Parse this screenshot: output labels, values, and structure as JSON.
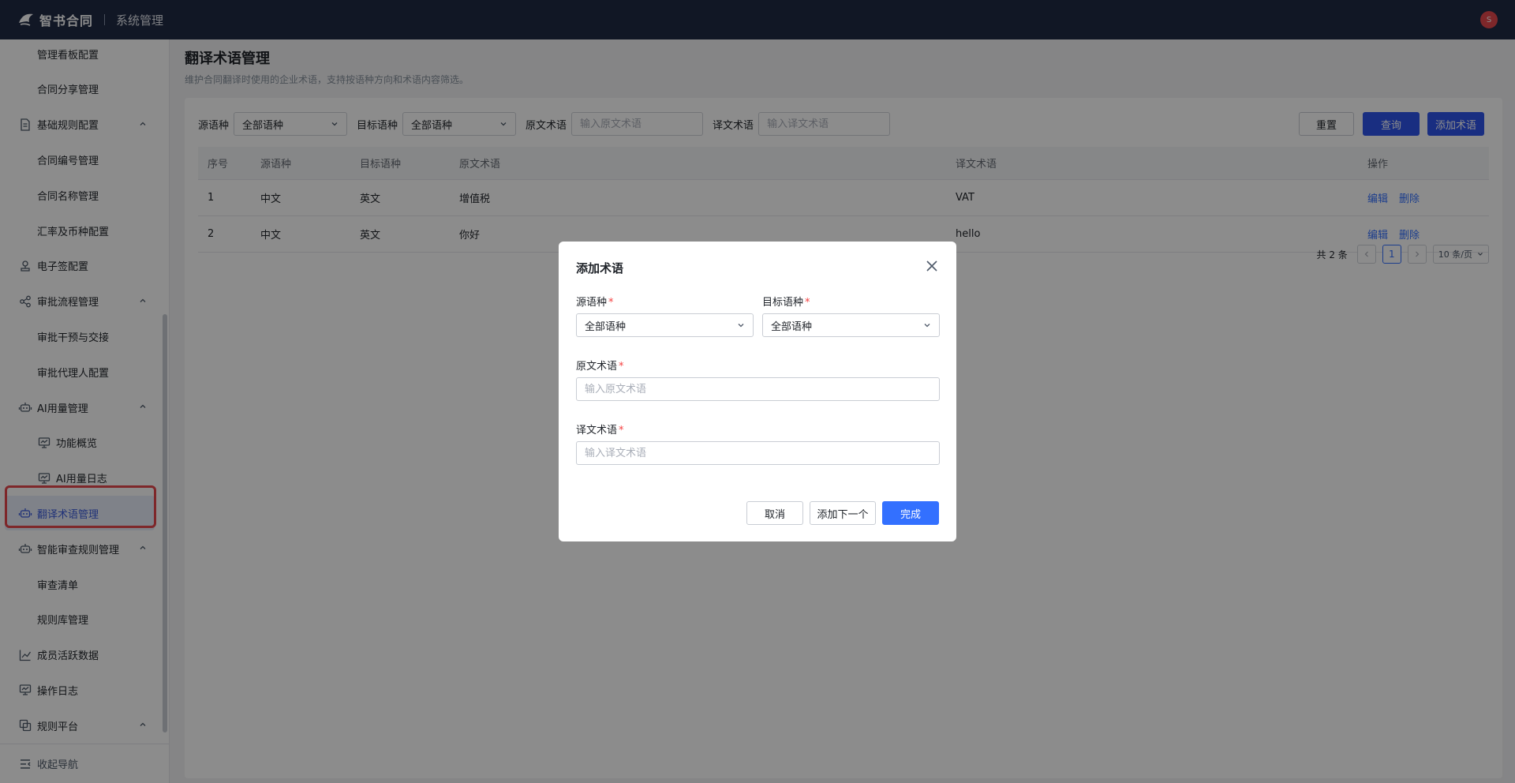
{
  "header": {
    "brand": "智书合同",
    "system": "系统管理",
    "avatar_text": "S"
  },
  "sidebar": {
    "items": [
      {
        "label": "管理看板配置",
        "type": "child"
      },
      {
        "label": "合同分享管理",
        "type": "child"
      },
      {
        "label": "基础规则配置",
        "type": "group",
        "icon": "rules-doc-icon",
        "expanded": true
      },
      {
        "label": "合同编号管理",
        "type": "child"
      },
      {
        "label": "合同名称管理",
        "type": "child"
      },
      {
        "label": "汇率及币种配置",
        "type": "child"
      },
      {
        "label": "电子签配置",
        "type": "group",
        "icon": "stamp-icon"
      },
      {
        "label": "审批流程管理",
        "type": "group",
        "icon": "flow-icon",
        "expanded": true
      },
      {
        "label": "审批干预与交接",
        "type": "child"
      },
      {
        "label": "审批代理人配置",
        "type": "child"
      },
      {
        "label": "AI用量管理",
        "type": "group",
        "icon": "robot-icon",
        "expanded": true
      },
      {
        "label": "功能概览",
        "type": "child",
        "icon": "monitor-icon"
      },
      {
        "label": "AI用量日志",
        "type": "child",
        "icon": "monitor-icon"
      },
      {
        "label": "翻译术语管理",
        "type": "group",
        "icon": "robot-icon",
        "active": true
      },
      {
        "label": "智能审查规则管理",
        "type": "group",
        "icon": "robot-icon",
        "expanded": true
      },
      {
        "label": "审查清单",
        "type": "child"
      },
      {
        "label": "规则库管理",
        "type": "child"
      },
      {
        "label": "成员活跃数据",
        "type": "group",
        "icon": "line-chart-icon"
      },
      {
        "label": "操作日志",
        "type": "group",
        "icon": "monitor-icon"
      },
      {
        "label": "规则平台",
        "type": "group",
        "icon": "copy-icon",
        "expanded": true
      }
    ],
    "collapse_label": "收起导航"
  },
  "page": {
    "title": "翻译术语管理",
    "description": "维护合同翻译时使用的企业术语，支持按语种方向和术语内容筛选。"
  },
  "filters": {
    "source_lang_label": "源语种",
    "source_lang_value": "全部语种",
    "target_lang_label": "目标语种",
    "target_lang_value": "全部语种",
    "source_term_label": "原文术语",
    "source_term_placeholder": "输入原文术语",
    "target_term_label": "译文术语",
    "target_term_placeholder": "输入译文术语",
    "reset_label": "重置",
    "query_label": "查询",
    "add_label": "添加术语"
  },
  "table": {
    "columns": [
      "序号",
      "源语种",
      "目标语种",
      "原文术语",
      "译文术语",
      "操作"
    ],
    "rows": [
      {
        "index": "1",
        "source_lang": "中文",
        "target_lang": "英文",
        "source_term": "增值税",
        "target_term": "VAT"
      },
      {
        "index": "2",
        "source_lang": "中文",
        "target_lang": "英文",
        "source_term": "你好",
        "target_term": "hello"
      }
    ],
    "edit_label": "编辑",
    "delete_label": "删除"
  },
  "pagination": {
    "total_text": "共 2 条",
    "current_page": "1",
    "page_size": "10 条/页"
  },
  "modal": {
    "title": "添加术语",
    "source_lang_label": "源语种",
    "source_lang_value": "全部语种",
    "target_lang_label": "目标语种",
    "target_lang_value": "全部语种",
    "source_term_label": "原文术语",
    "source_term_placeholder": "输入原文术语",
    "target_term_label": "译文术语",
    "target_term_placeholder": "输入译文术语",
    "required_mark": "*",
    "cancel_label": "取消",
    "add_next_label": "添加下一个",
    "done_label": "完成"
  },
  "colors": {
    "topbar": "#1f2a44",
    "primary": "#3370ff",
    "active_nav_bg": "#e8edf9",
    "highlight": "#e5484d"
  }
}
